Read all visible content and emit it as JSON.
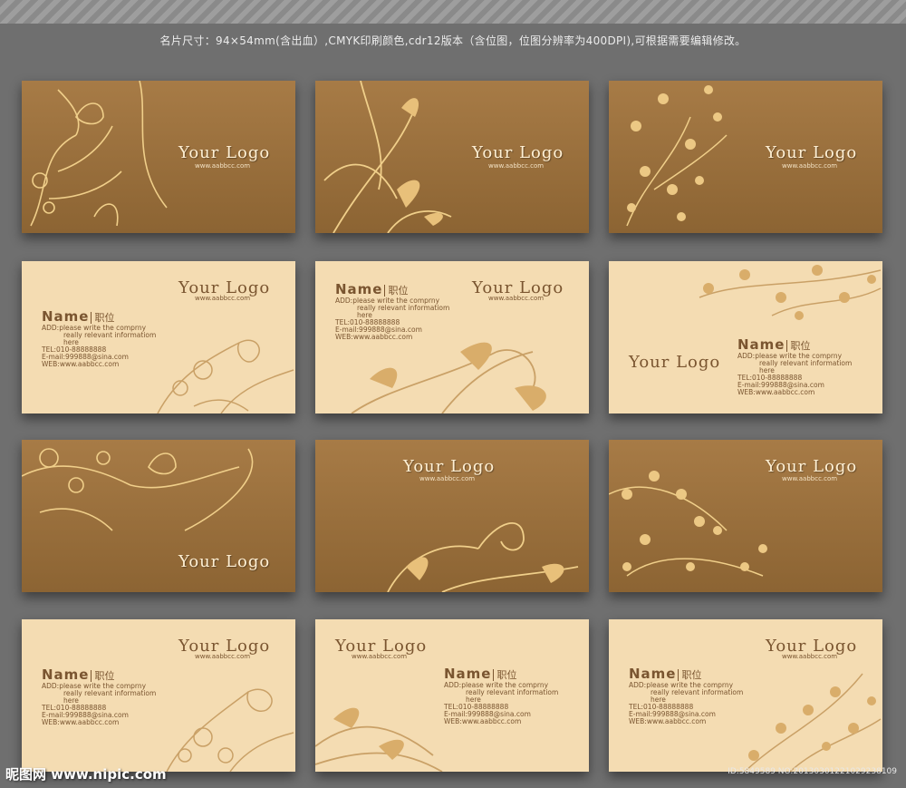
{
  "header": "名片尺寸：94×54mm(含出血）,CMYK印刷颜色,cdr12版本（含位图，位图分辨率为400DPI),可根据需要编辑修改。",
  "card": {
    "logo": "Your Logo",
    "url": "www.aabbcc.com",
    "name": "Name",
    "title": "职位",
    "add1": "ADD:please write the comprny",
    "add2": "really relevant informatiom",
    "add3": "here",
    "tel": "TEL:010-88888888",
    "email": "E-mail:999888@sina.com",
    "web": "WEB:www.aabbcc.com"
  },
  "colors": {
    "dark_card": "#9a703d",
    "light_card": "#f4dcb2",
    "text_brown": "#7a5530",
    "background": "#6f6f6f"
  },
  "footer": {
    "watermark": "昵图网 www.nipic.com",
    "id": "ID:5849589 NO:20130301221029238109"
  }
}
